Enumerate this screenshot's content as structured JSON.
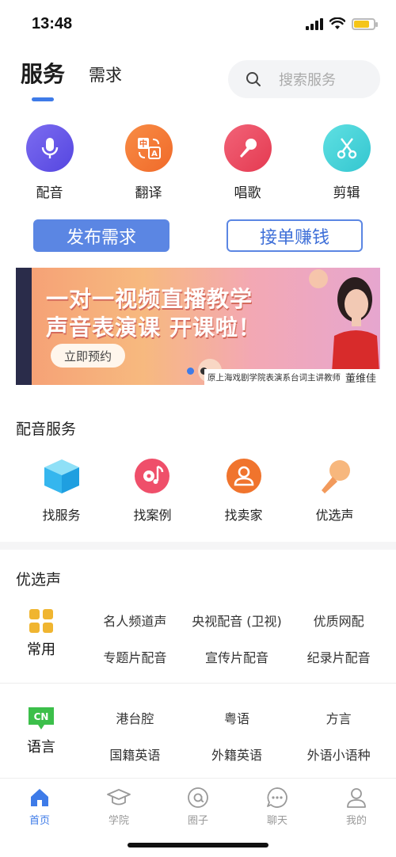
{
  "status_bar": {
    "time": "13:48"
  },
  "header": {
    "tabs": [
      {
        "label": "服务",
        "active": true
      },
      {
        "label": "需求",
        "active": false
      }
    ],
    "search": {
      "placeholder": "搜索服务"
    }
  },
  "services": [
    {
      "label": "配音",
      "icon": "microphone-icon",
      "color": "#6a5ae8"
    },
    {
      "label": "翻译",
      "icon": "translate-icon",
      "color": "#f47a35"
    },
    {
      "label": "唱歌",
      "icon": "karaoke-mic-icon",
      "color": "#ec4a5e"
    },
    {
      "label": "剪辑",
      "icon": "scissors-icon",
      "color": "#4cd5d8"
    }
  ],
  "actions": {
    "publish": "发布需求",
    "earn": "接单赚钱"
  },
  "banner": {
    "line1": "一对一视频直播教学",
    "line2": "声音表演课 开课啦！",
    "cta": "立即预约",
    "caption": "原上海戏剧学院表演系台词主讲教师",
    "caption_name": "董维佳"
  },
  "dubbing_section": {
    "title": "配音服务",
    "items": [
      {
        "label": "找服务",
        "icon": "cube-icon"
      },
      {
        "label": "找案例",
        "icon": "music-disc-icon"
      },
      {
        "label": "找卖家",
        "icon": "person-icon"
      },
      {
        "label": "优选声",
        "icon": "microphone-icon"
      }
    ]
  },
  "selected_section": {
    "title": "优选声",
    "common": {
      "name": "常用",
      "icon": "grid-icon",
      "items": [
        "名人频道声",
        "央视配音 (卫视)",
        "优质网配",
        "专题片配音",
        "宣传片配音",
        "纪录片配音"
      ]
    },
    "language": {
      "name": "语言",
      "icon": "cn-badge-icon",
      "badge": "CN",
      "items": [
        "港台腔",
        "粤语",
        "方言",
        "国籍英语",
        "外籍英语",
        "外语小语种"
      ]
    }
  },
  "bottom_nav": [
    {
      "label": "首页",
      "icon": "home-icon",
      "active": true
    },
    {
      "label": "学院",
      "icon": "graduation-cap-icon",
      "active": false
    },
    {
      "label": "圈子",
      "icon": "at-circle-icon",
      "active": false
    },
    {
      "label": "聊天",
      "icon": "chat-bubble-icon",
      "active": false
    },
    {
      "label": "我的",
      "icon": "user-icon",
      "active": false
    }
  ],
  "colors": {
    "accent": "#3e7be8",
    "button": "#5b86e3"
  }
}
